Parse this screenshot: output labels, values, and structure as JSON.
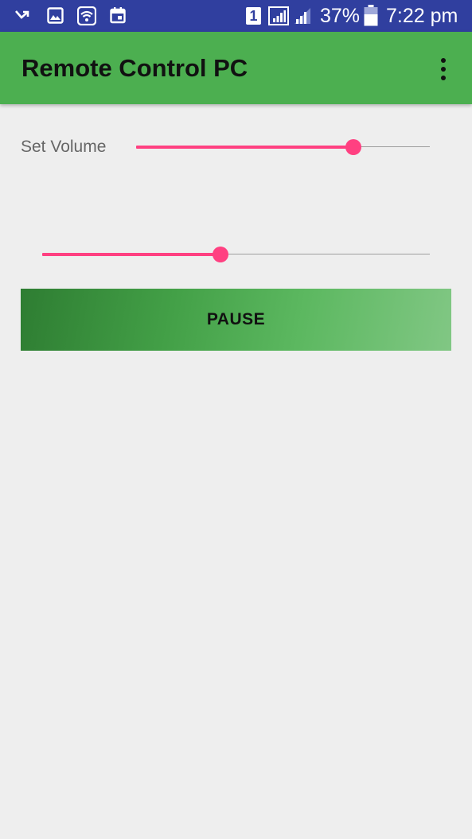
{
  "status_bar": {
    "sim_label": "1",
    "battery_percent": "37%",
    "time": "7:22 pm",
    "background_color": "#303F9F",
    "icons": [
      "missed-call-icon",
      "gallery-icon",
      "wifi-icon",
      "calendar-icon",
      "sim-icon",
      "signal-icon",
      "signal-icon",
      "battery-icon"
    ]
  },
  "app_bar": {
    "title": "Remote Control PC",
    "background_color": "#4CAF50",
    "menu_icon": "more-vert-icon"
  },
  "main": {
    "volume_label": "Set Volume",
    "volume_level": 0.74,
    "position_level": 0.46,
    "accent_color": "#FF4081",
    "pause_label": "PAUSE"
  }
}
